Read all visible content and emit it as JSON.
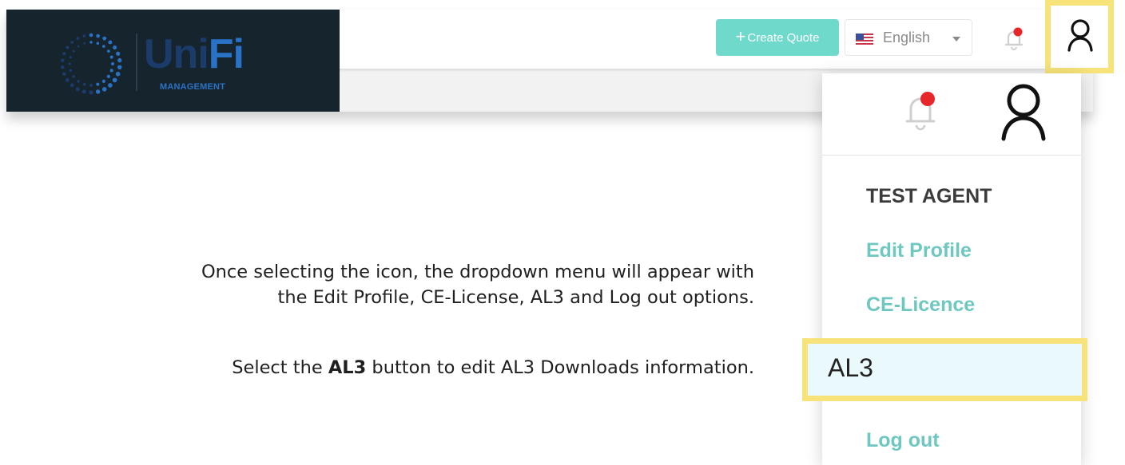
{
  "header": {
    "logo": {
      "brand_left": "Uni",
      "brand_right": "Fi",
      "sub": "MANAGEMENT"
    },
    "create_quote": {
      "icon": "plus-icon",
      "label": "Create Quote"
    },
    "language": {
      "flag": "us-flag-icon",
      "value": "English"
    },
    "notification_icon": "bell-icon",
    "user_icon": "user-icon"
  },
  "dropdown": {
    "user_name": "TEST AGENT",
    "items": [
      {
        "label": "Edit Profile"
      },
      {
        "label": "CE-Licence"
      },
      {
        "label": "AL3"
      },
      {
        "label": "Log out"
      }
    ]
  },
  "instructions": {
    "line1": "Once selecting the icon, the dropdown menu will appear with",
    "line2": "the Edit Profile, CE-License, AL3 and Log out options.",
    "line3_prefix": "Select the ",
    "line3_bold": "AL3",
    "line3_suffix": " button to edit AL3 Downloads information."
  },
  "colors": {
    "accent": "#6fd9cc",
    "menu_link": "#6ec8c0",
    "highlight": "#f7e37a",
    "logo_bg": "#16242e",
    "badge": "#e8262a"
  }
}
